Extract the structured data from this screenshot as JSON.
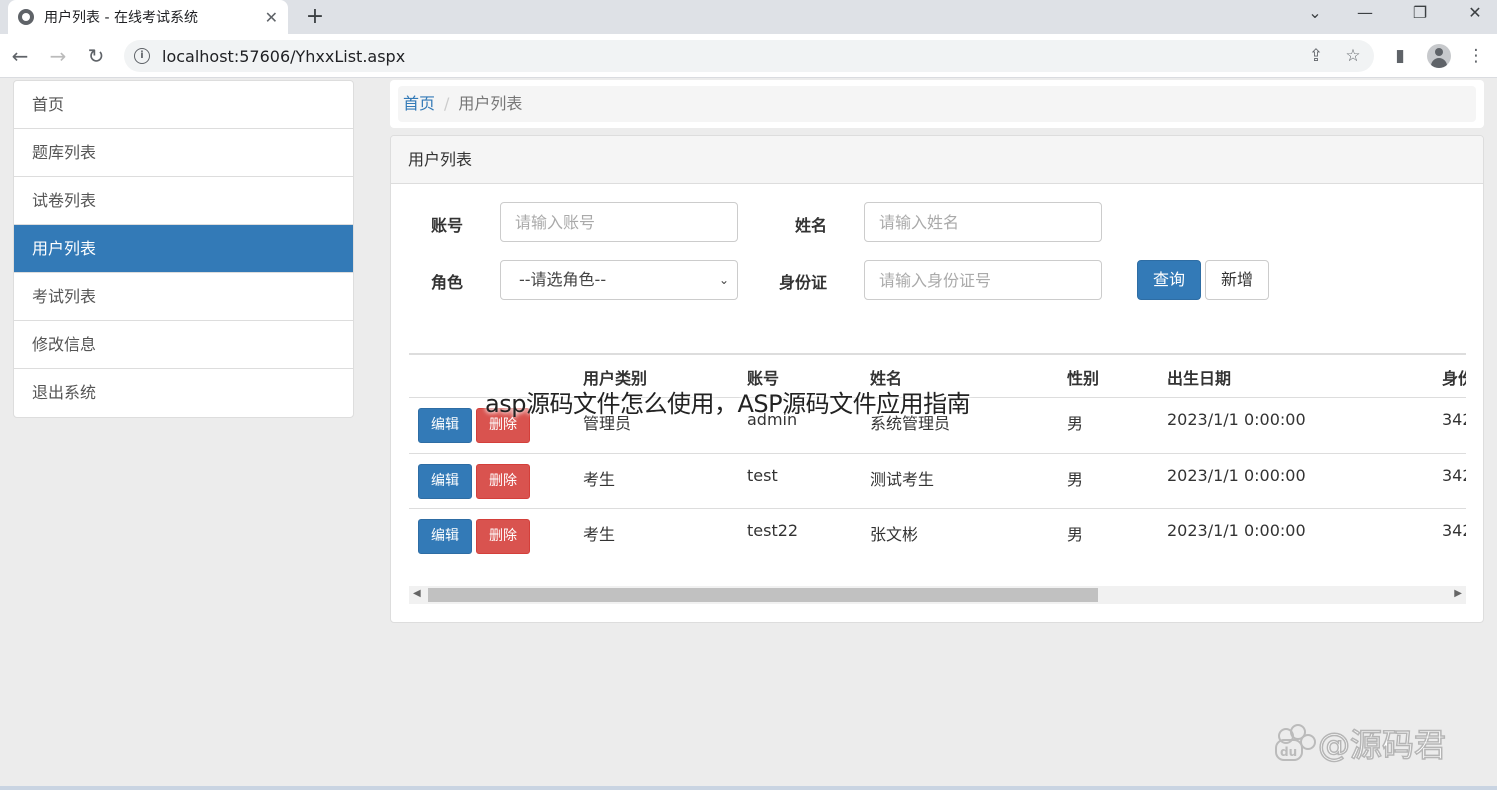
{
  "browser": {
    "tab_title": "用户列表 - 在线考试系统",
    "url_host": "localhost:",
    "url_path": "57606/YhxxList.aspx"
  },
  "sidebar": {
    "items": [
      {
        "label": "首页",
        "active": false
      },
      {
        "label": "题库列表",
        "active": false
      },
      {
        "label": "试卷列表",
        "active": false
      },
      {
        "label": "用户列表",
        "active": true
      },
      {
        "label": "考试列表",
        "active": false
      },
      {
        "label": "修改信息",
        "active": false
      },
      {
        "label": "退出系统",
        "active": false
      }
    ]
  },
  "breadcrumb": {
    "home": "首页",
    "separator": "/",
    "current": "用户列表"
  },
  "panel": {
    "title": "用户列表"
  },
  "search_form": {
    "account_label": "账号",
    "account_placeholder": "请输入账号",
    "name_label": "姓名",
    "name_placeholder": "请输入姓名",
    "role_label": "角色",
    "role_selected": "--请选角色--",
    "idcard_label": "身份证",
    "idcard_placeholder": "请输入身份证号",
    "query_button": "查询",
    "add_button": "新增"
  },
  "table": {
    "headers": [
      "用户类别",
      "账号",
      "姓名",
      "性别",
      "出生日期",
      "身份"
    ],
    "edit_label": "编辑",
    "delete_label": "删除",
    "rows": [
      {
        "type": "管理员",
        "account": "admin",
        "name": "系统管理员",
        "gender": "男",
        "birth": "2023/1/1 0:00:00",
        "idcard": "342"
      },
      {
        "type": "考生",
        "account": "test",
        "name": "测试考生",
        "gender": "男",
        "birth": "2023/1/1 0:00:00",
        "idcard": "342"
      },
      {
        "type": "考生",
        "account": "test22",
        "name": "张文彬",
        "gender": "男",
        "birth": "2023/1/1 0:00:00",
        "idcard": "342"
      }
    ]
  },
  "overlay": {
    "caption": "asp源码文件怎么使用，ASP源码文件应用指南",
    "watermark": "@源码君"
  },
  "colors": {
    "primary": "#337ab7",
    "danger": "#d9534f",
    "page_bg": "#ececec"
  }
}
